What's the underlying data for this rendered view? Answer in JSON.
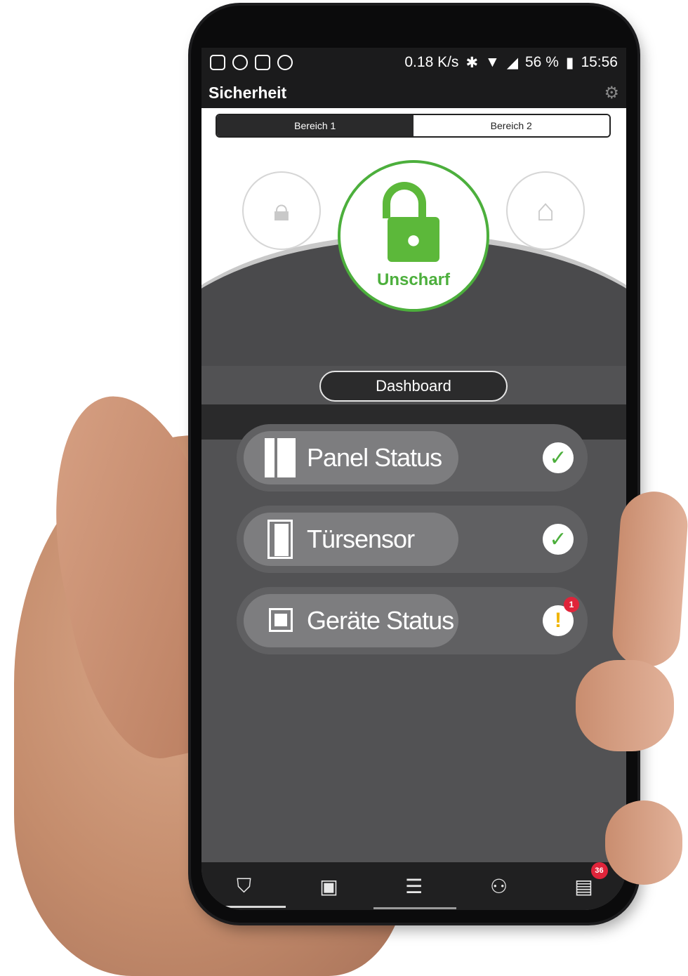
{
  "statusbar": {
    "speed": "0.18 K/s",
    "battery": "56 %",
    "time": "15:56"
  },
  "appbar": {
    "title": "Sicherheit"
  },
  "segments": [
    "Bereich 1",
    "Bereich 2"
  ],
  "mode": {
    "current": "Unscharf"
  },
  "dashboard_label": "Dashboard",
  "rows": [
    {
      "label": "Panel Status",
      "status": "ok"
    },
    {
      "label": "Türsensor",
      "status": "ok"
    },
    {
      "label": "Geräte Status",
      "status": "warning",
      "badge": "1"
    }
  ],
  "bottom_nav": {
    "list_badge": "36"
  },
  "colors": {
    "accent_green": "#4caf3c",
    "warning": "#f0b400",
    "badge_red": "#e0243a"
  }
}
